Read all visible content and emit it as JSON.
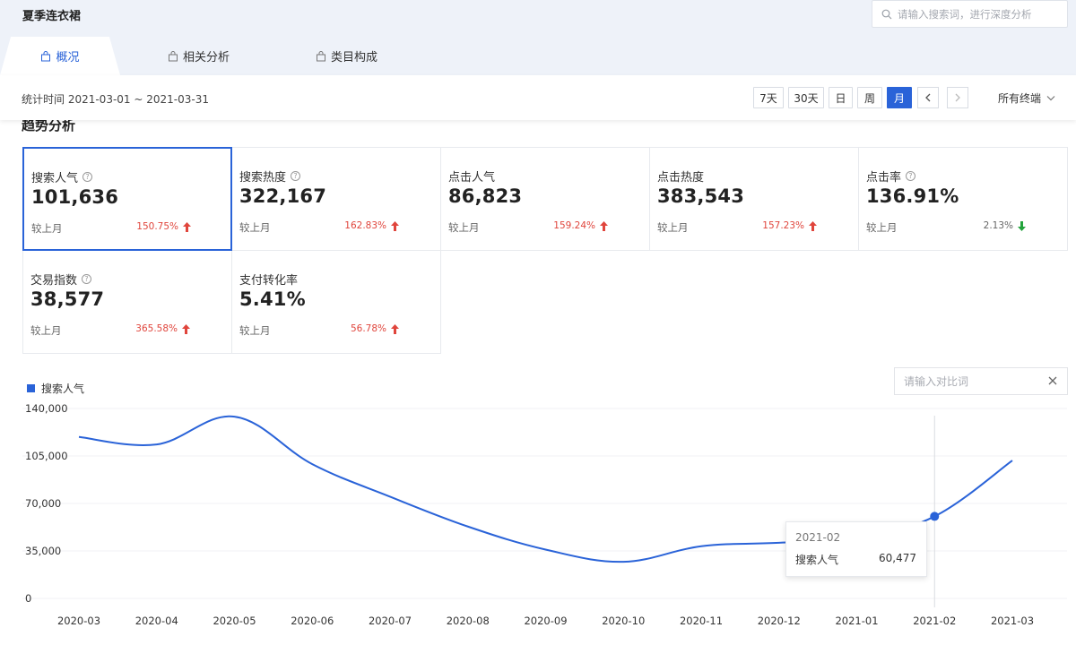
{
  "header": {
    "title": "夏季连衣裙",
    "search_placeholder": "请输入搜索词，进行深度分析"
  },
  "tabs": [
    {
      "label": "概况",
      "active": true
    },
    {
      "label": "相关分析",
      "active": false
    },
    {
      "label": "类目构成",
      "active": false
    }
  ],
  "date_bar": {
    "stat_time": "统计时间 2021-03-01 ~ 2021-03-31",
    "ranges": [
      "7天",
      "30天",
      "日",
      "周",
      "月"
    ],
    "active_range": "月",
    "terminal": "所有终端"
  },
  "section": {
    "title": "趋势分析"
  },
  "metrics": [
    {
      "name": "搜索人气",
      "help": true,
      "value": "101,636",
      "compare_label": "较上月",
      "change": "150.75%",
      "direction": "up",
      "selected": true
    },
    {
      "name": "搜索热度",
      "help": true,
      "value": "322,167",
      "compare_label": "较上月",
      "change": "162.83%",
      "direction": "up",
      "selected": false
    },
    {
      "name": "点击人气",
      "help": false,
      "value": "86,823",
      "compare_label": "较上月",
      "change": "159.24%",
      "direction": "up",
      "selected": false
    },
    {
      "name": "点击热度",
      "help": false,
      "value": "383,543",
      "compare_label": "较上月",
      "change": "157.23%",
      "direction": "up",
      "selected": false
    },
    {
      "name": "点击率",
      "help": true,
      "value": "136.91%",
      "compare_label": "较上月",
      "change": "2.13%",
      "direction": "down",
      "selected": false
    },
    {
      "name": "交易指数",
      "help": true,
      "value": "38,577",
      "compare_label": "较上月",
      "change": "365.58%",
      "direction": "up",
      "selected": false
    },
    {
      "name": "支付转化率",
      "help": false,
      "value": "5.41%",
      "compare_label": "较上月",
      "change": "56.78%",
      "direction": "up",
      "selected": false
    }
  ],
  "colors": {
    "accent": "#2a63d8",
    "up": "#e0453c",
    "down": "#23a33c"
  },
  "compare": {
    "placeholder": "请输入对比词"
  },
  "chart_data": {
    "type": "line",
    "x": [
      "2020-03",
      "2020-04",
      "2020-05",
      "2020-06",
      "2020-07",
      "2020-08",
      "2020-09",
      "2020-10",
      "2020-11",
      "2020-12",
      "2021-01",
      "2021-02",
      "2021-03"
    ],
    "series": [
      {
        "name": "搜索人气",
        "values": [
          119000,
          113500,
          134000,
          99000,
          75000,
          53000,
          36000,
          27000,
          38500,
          41000,
          44500,
          60477,
          101636
        ]
      }
    ],
    "y_ticks": [
      "140,000",
      "105,000",
      "70,000",
      "35,000",
      "0"
    ],
    "ylim": [
      0,
      140000
    ],
    "grid": true,
    "legend": "top-left",
    "tooltip": {
      "x": "2021-02",
      "series": "搜索人气",
      "value": "60,477"
    }
  }
}
